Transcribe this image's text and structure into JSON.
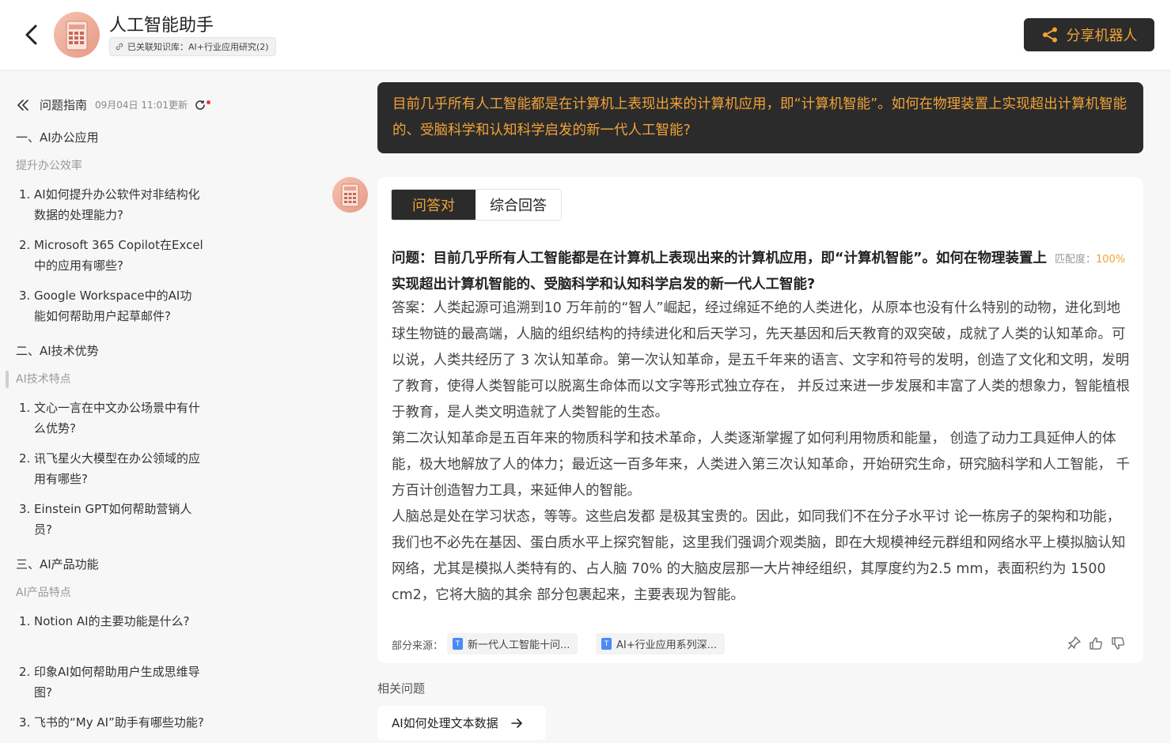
{
  "header": {
    "title": "人工智能助手",
    "kb_tag": "已关联知识库：AI+行业应用研究(2)",
    "share_label": "分享机器人"
  },
  "sidebar": {
    "title": "问题指南",
    "updated": "09月04日 11:01更新",
    "sections": [
      {
        "title": "一、AI办公应用",
        "subtitle": "提升办公效率",
        "items": [
          {
            "num": "1.",
            "text": "AI如何提升办公软件对非结构化数据的处理能力?"
          },
          {
            "num": "2.",
            "text": "Microsoft 365 Copilot在Excel中的应用有哪些?"
          },
          {
            "num": "3.",
            "text": "Google Workspace中的AI功能如何帮助用户起草邮件?"
          }
        ]
      },
      {
        "title": "二、AI技术优势",
        "subtitle": "AI技术特点",
        "items": [
          {
            "num": "1.",
            "text": "文心一言在中文办公场景中有什么优势?"
          },
          {
            "num": "2.",
            "text": "讯飞星火大模型在办公领域的应用有哪些?"
          },
          {
            "num": "3.",
            "text": "Einstein GPT如何帮助营销人员?"
          }
        ]
      },
      {
        "title": "三、AI产品功能",
        "subtitle": "AI产品特点",
        "items": [
          {
            "num": "1.",
            "text": "Notion AI的主要功能是什么?"
          },
          {
            "num": "2.",
            "text": "印象AI如何帮助用户生成思维导图?"
          },
          {
            "num": "3.",
            "text": "飞书的“My AI”助手有哪些功能?"
          }
        ]
      }
    ]
  },
  "chat": {
    "user_question": "目前几乎所有人工智能都是在计算机上表现出来的计算机应用，即“计算机智能”。如何在物理装置上实现超出计算机智能的、受脑科学和认知科学启发的新一代人工智能?",
    "tabs": [
      "问答对",
      "综合回答"
    ],
    "question_line": "问题：目前几乎所有人工智能都是在计算机上表现出来的计算机应用，即“计算机智能”。如何在物理装置上实现超出计算机智能的、受脑科学和认知科学启发的新一代人工智能?",
    "match_label": "匹配度：",
    "match_value": "100%",
    "answer_paragraphs": [
      "答案：人类起源可追溯到10 万年前的“智人”崛起，经过绵延不绝的人类进化，从原本也没有什么特别的动物，进化到地球生物链的最高端，人脑的组织结构的持续进化和后天学习，先天基因和后天教育的双突破，成就了人类的认知革命。可以说，人类共经历了 3 次认知革命。第一次认知革命，是五千年来的语言、文字和符号的发明，创造了文化和文明，发明了教育，使得人类智能可以脱离生命体而以文字等形式独立存在， 并反过来进一步发展和丰富了人类的想象力，智能植根于教育，是人类文明造就了人类智能的生态。",
      "第二次认知革命是五百年来的物质科学和技术革命，人类逐渐掌握了如何利用物质和能量， 创造了动力工具延伸人的体能，极大地解放了人的体力；最近这一百多年来，人类进入第三次认知革命，开始研究生命，研究脑科学和人工智能， 千方百计创造智力工具，来延伸人的智能。",
      "人脑总是处在学习状态，等等。这些启发都 是极其宝贵的。因此，如同我们不在分子水平讨 论一栋房子的架构和功能，我们也不必先在基因、蛋白质水平上探究智能，这里我们强调介观类脑，即在大规模神经元群组和网络水平上模拟脑认知网络，尤其是模拟人类特有的、占人脑 70% 的大脑皮层那一大片神经组织，其厚度约为2.5 mm，表面积约为 1500 cm2，它将大脑的其余 部分包裹起来，主要表现为智能。"
    ],
    "sources_label": "部分来源：",
    "sources": [
      "新一代人工智能十问...",
      "AI+行业应用系列深..."
    ],
    "related_title": "相关问题",
    "related": [
      "AI如何处理文本数据"
    ]
  },
  "icons": [
    "back-icon",
    "link-icon",
    "share-icon",
    "collapse-icon",
    "refresh-icon",
    "doc-icon",
    "pin-icon",
    "thumbs-up-icon",
    "thumbs-down-icon",
    "arrow-right-icon"
  ],
  "colors": {
    "accent": "#f0a338",
    "dark": "#2b2b2b",
    "background": "#f7f7f7"
  }
}
